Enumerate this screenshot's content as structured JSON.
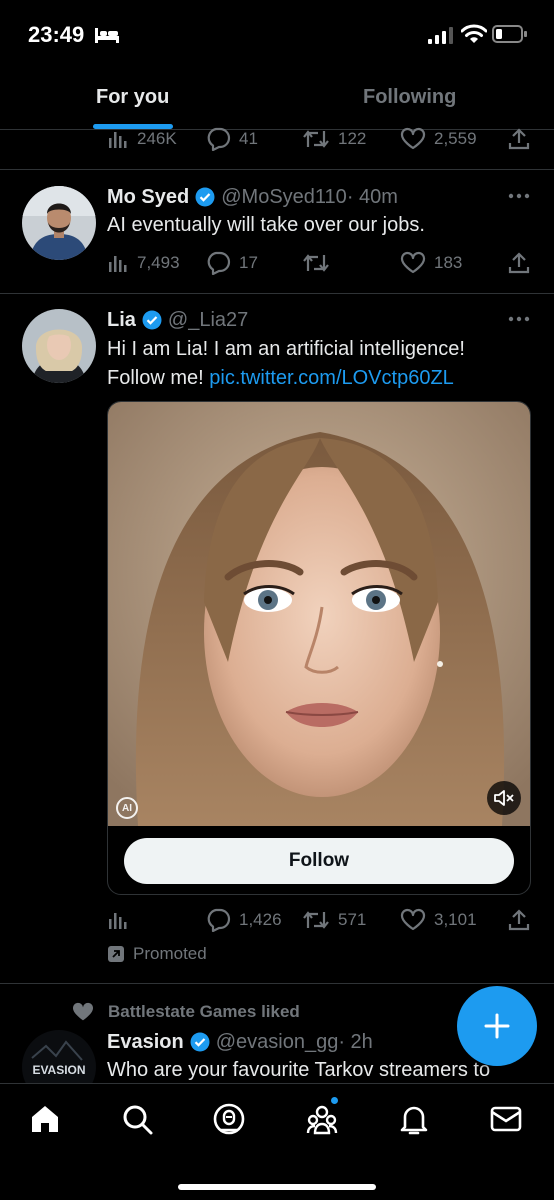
{
  "status_bar": {
    "time": "23:49"
  },
  "tabs": [
    {
      "label": "For you",
      "active": true
    },
    {
      "label": "Following",
      "active": false
    }
  ],
  "prev_tweet": {
    "views": "246K",
    "replies": "41",
    "retweets": "122",
    "likes": "2,559"
  },
  "tweet1": {
    "name": "Mo Syed",
    "handle": "@MoSyed110",
    "time": "· 40m",
    "text": "AI eventually will take over our jobs.",
    "views": "7,493",
    "replies": "17",
    "retweets": "",
    "likes": "183"
  },
  "tweet2": {
    "name": "Lia",
    "handle": "@_Lia27",
    "text_line1": "Hi I am Lia! I am an artificial intelligence!",
    "text_line2": "Follow me! ",
    "link": "pic.twitter.com/LOVctp60ZL",
    "ai_badge": "AI",
    "follow_label": "Follow",
    "replies": "1,426",
    "retweets": "571",
    "likes": "3,101",
    "promoted": "Promoted"
  },
  "tweet3": {
    "social_context": "Battlestate Games liked",
    "name": "Evasion",
    "handle": "@evasion_gg",
    "time": "· 2h",
    "text": "Who are your favourite Tarkov streamers to",
    "avatar_text": "EVASION"
  },
  "colors": {
    "accent": "#1d9bf0",
    "muted": "#71767b",
    "text": "#e7e9ea",
    "background": "#000000"
  },
  "icons": [
    "bed-icon",
    "signal-icon",
    "wifi-icon",
    "battery-icon",
    "views-icon",
    "reply-icon",
    "retweet-icon",
    "like-icon",
    "share-icon",
    "verified-icon",
    "more-icon",
    "mute-icon",
    "promoted-icon",
    "heart-icon",
    "compose-icon",
    "home-icon",
    "search-icon",
    "spaces-icon",
    "communities-icon",
    "notifications-icon",
    "messages-icon"
  ]
}
